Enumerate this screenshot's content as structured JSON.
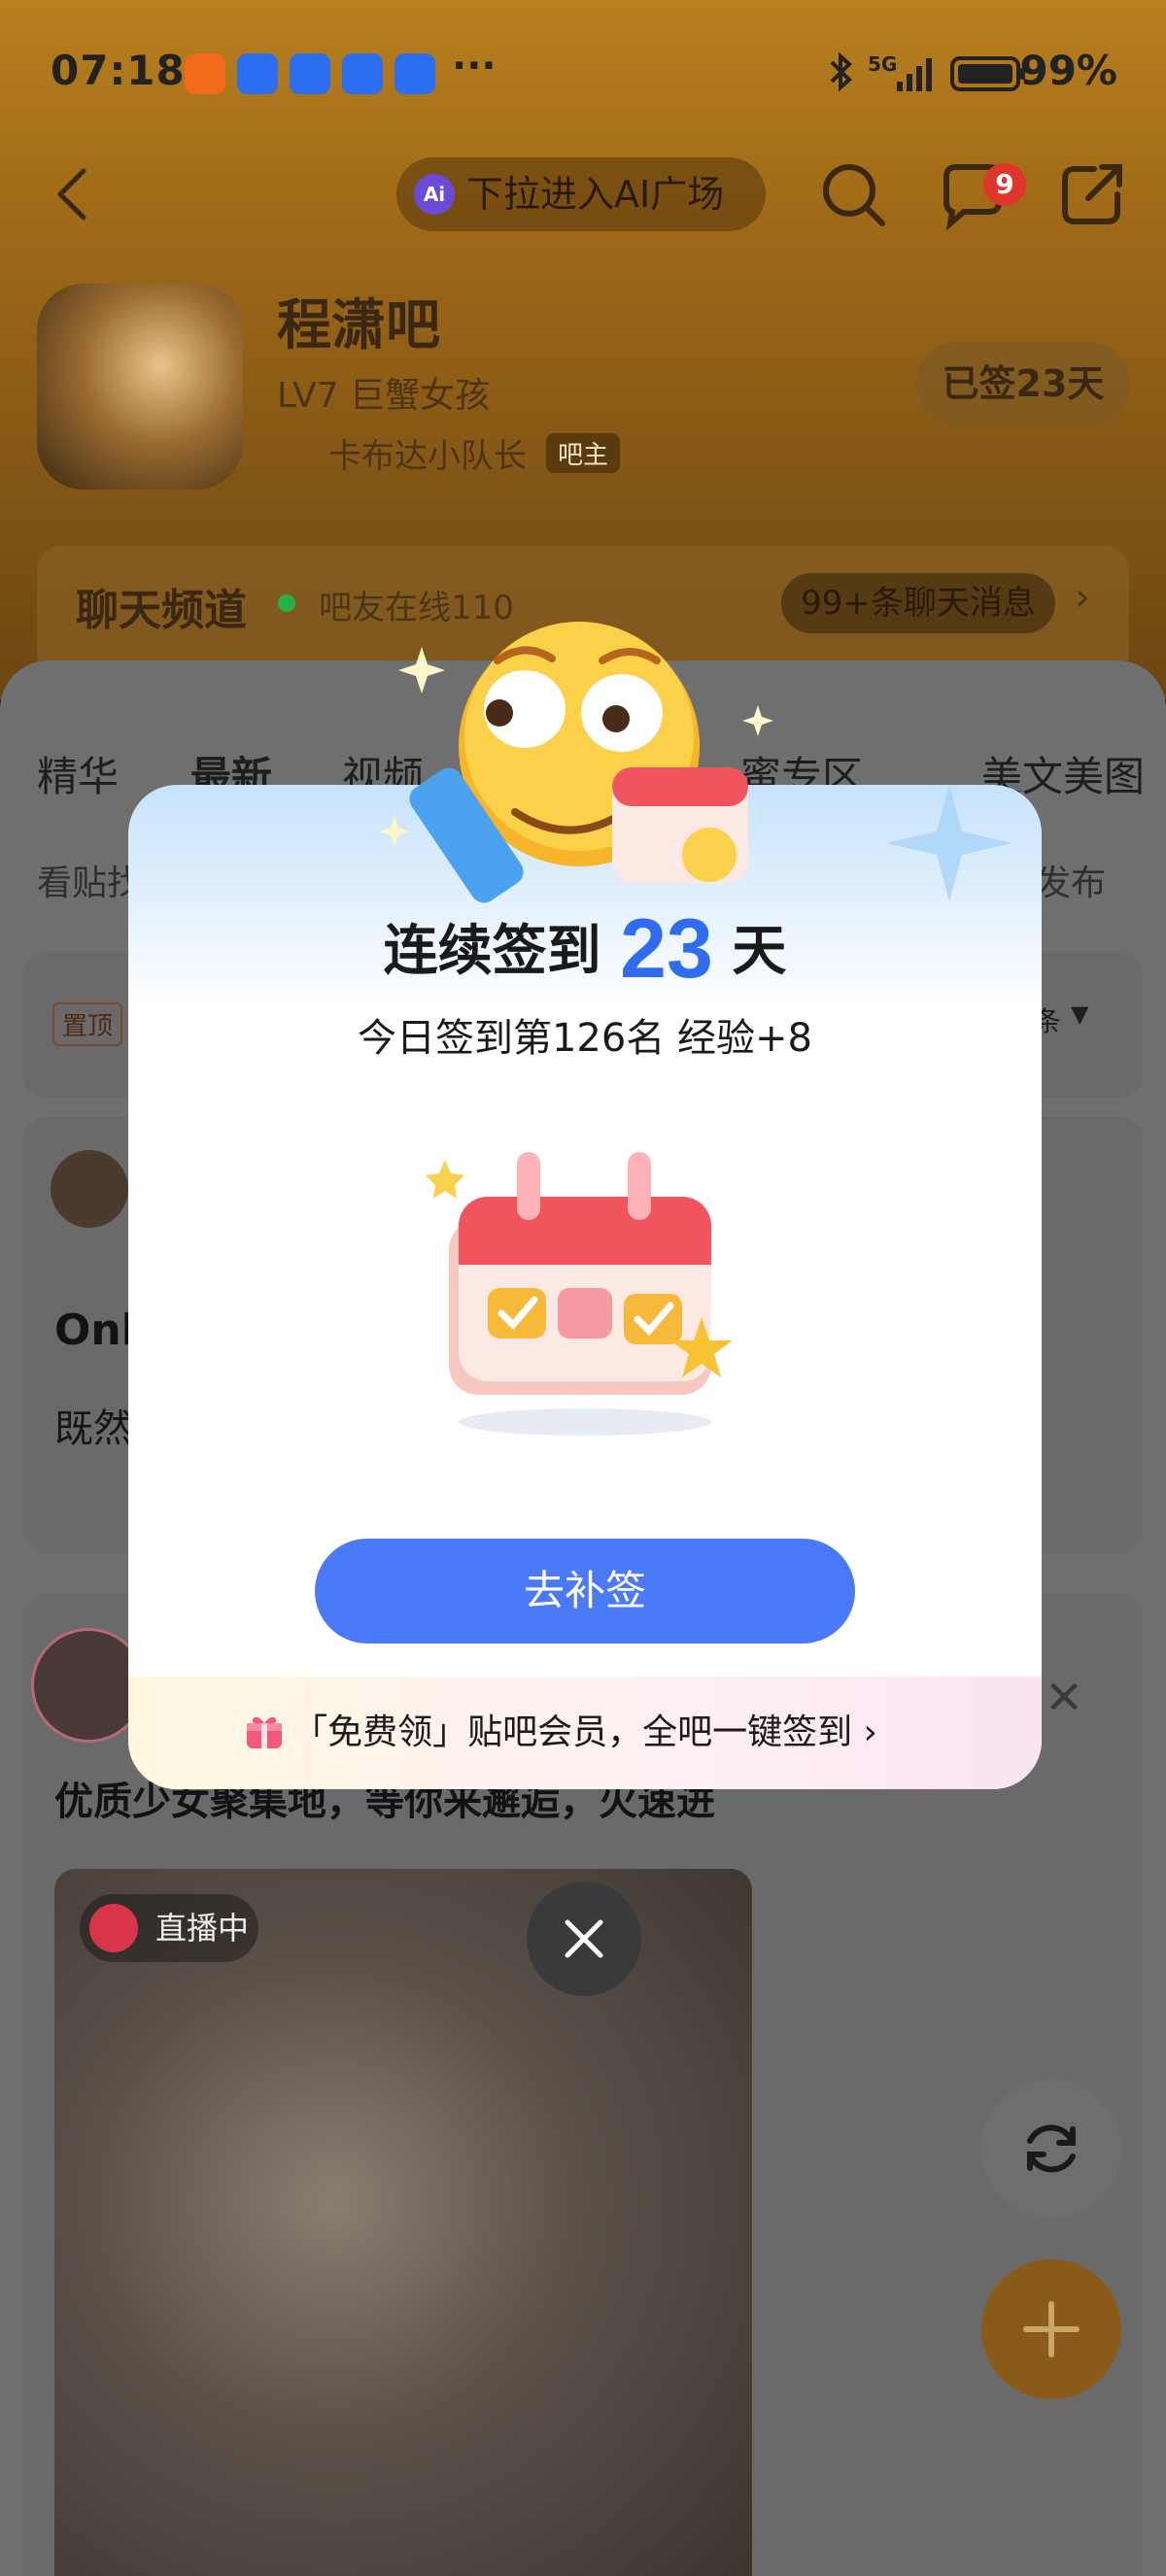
{
  "status_bar": {
    "time": "07:18",
    "battery": "99%",
    "more": "···",
    "network": "5G"
  },
  "header": {
    "ai_pill": "下拉进入AI广场",
    "ai_badge": "Ai",
    "message_badge": "9"
  },
  "forum": {
    "title": "程潇吧",
    "level": "LV7 巨蟹女孩",
    "owner_name": "卡布达小队长",
    "owner_tag": "吧主",
    "signed_days": "已签23天"
  },
  "chat": {
    "title": "聊天频道",
    "online": "吧友在线110",
    "messages": "99+条聊天消息"
  },
  "tabs": [
    "精华",
    "最新",
    "视频",
    "蜜专区",
    "美文美图"
  ],
  "search": {
    "placeholder": "看贴找",
    "publish": "发布"
  },
  "pinned": {
    "tag": "置顶",
    "sort": "条"
  },
  "posts": {
    "post1_title": "Onl",
    "post1_text": "既然",
    "post2_title": "优质少女聚集地，等你来邂逅，火速进",
    "live_label": "直播中"
  },
  "modal": {
    "title_prefix": "连续签到",
    "days": "23",
    "title_suffix": "天",
    "subtitle": "今日签到第126名 经验+8",
    "cta": "去补签",
    "footer": "「免费领」贴吧会员，全吧一键签到"
  },
  "colors": {
    "accent_blue": "#2f6cf0",
    "button_blue": "#4a7af7",
    "header_brown": "#a06a18"
  }
}
